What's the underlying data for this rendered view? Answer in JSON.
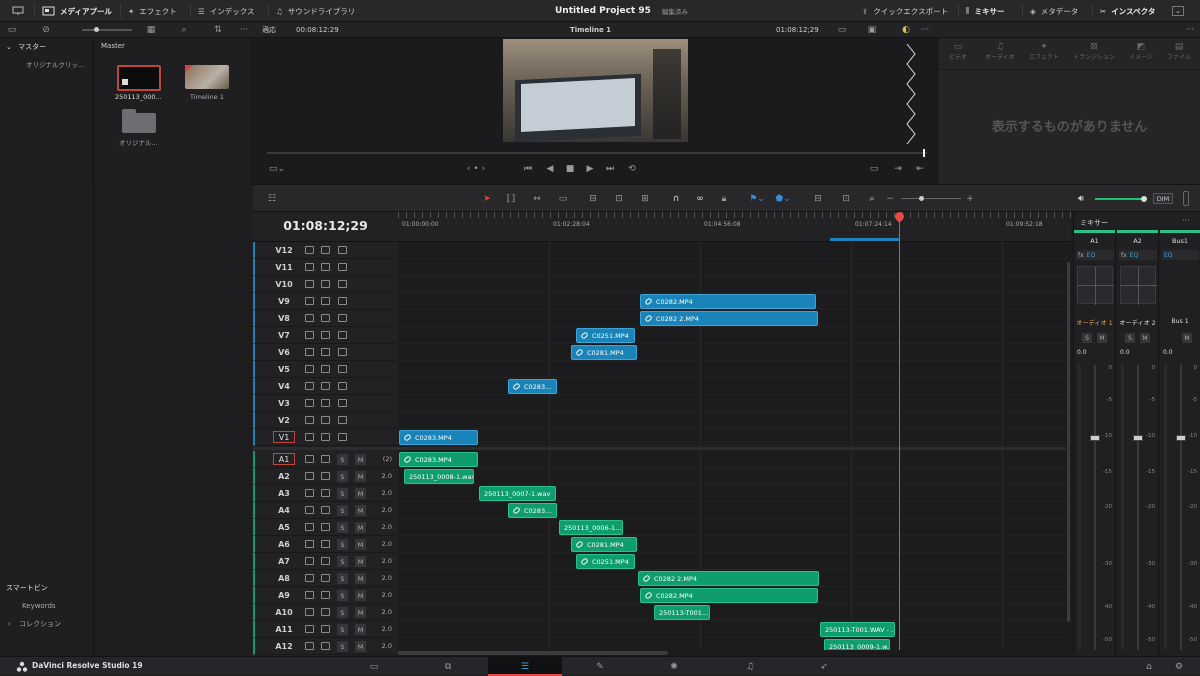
{
  "topbar": {
    "media_pool": "メディアプール",
    "effects": "エフェクト",
    "index": "インデックス",
    "sound_library": "サウンドライブラリ",
    "project_title": "Untitled Project 95",
    "project_status": "編集済み",
    "quick_export": "クイックエクスポート",
    "mixer": "ミキサー",
    "metadata": "メタデータ",
    "inspector": "インスペクタ"
  },
  "secondbar": {
    "fit": "適応",
    "timecode_left": "00:08:12:29",
    "timeline_name": "Timeline 1",
    "timecode_right": "01:08:12;29"
  },
  "left_panel": {
    "master_label": "マスター",
    "original_clips": "オリジナルクリッ...",
    "smart_bins": "スマートビン",
    "keywords": "Keywords",
    "collections": "コレクション"
  },
  "media_pool": {
    "header": "Master",
    "items": [
      {
        "label": "250113_000..."
      },
      {
        "label": "Timeline 1"
      },
      {
        "label": "オリジナル..."
      }
    ]
  },
  "inspector": {
    "tabs": [
      "ビデオ",
      "オーディオ",
      "エフェクト",
      "トランジション",
      "イメージ",
      "ファイル"
    ],
    "empty_message": "表示するものがありません"
  },
  "timeline": {
    "current_timecode": "01:08:12;29",
    "dim_label": "DIM",
    "ruler_labels": [
      "01:00:00:00",
      "01:02:28:04",
      "01:04:56:08",
      "01:07:24:14",
      "01:09:52:18"
    ],
    "video_tracks": [
      "V12",
      "V11",
      "V10",
      "V9",
      "V8",
      "V7",
      "V6",
      "V5",
      "V4",
      "V3",
      "V2",
      "V1"
    ],
    "audio_tracks": [
      {
        "name": "A1",
        "value": "(2)"
      },
      {
        "name": "A2",
        "value": "2.0"
      },
      {
        "name": "A3",
        "value": "2.0"
      },
      {
        "name": "A4",
        "value": "2.0"
      },
      {
        "name": "A5",
        "value": "2.0"
      },
      {
        "name": "A6",
        "value": "2.0"
      },
      {
        "name": "A7",
        "value": "2.0"
      },
      {
        "name": "A8",
        "value": "2.0"
      },
      {
        "name": "A9",
        "value": "2.0"
      },
      {
        "name": "A10",
        "value": "2.0"
      },
      {
        "name": "A11",
        "value": "2.0"
      },
      {
        "name": "A12",
        "value": "2.0"
      }
    ],
    "solo_label": "S",
    "mute_label": "M",
    "video_clips": [
      {
        "name": "C0282.MP4"
      },
      {
        "name": "C0282 2.MP4"
      },
      {
        "name": "C0251.MP4"
      },
      {
        "name": "C0281.MP4"
      },
      {
        "name": "C0283..."
      },
      {
        "name": "C0283.MP4"
      }
    ],
    "audio_clips": [
      {
        "name": "C0283.MP4"
      },
      {
        "name": "250113_0008-1.wav"
      },
      {
        "name": "250113_0007-1.wav"
      },
      {
        "name": "C0283..."
      },
      {
        "name": "250113_0006-1...."
      },
      {
        "name": "C0281.MP4"
      },
      {
        "name": "C0251.MP4"
      },
      {
        "name": "C0282 2.MP4"
      },
      {
        "name": "C0282.MP4"
      },
      {
        "name": "250113-T001..."
      },
      {
        "name": "250113-T001.WAV - ..."
      },
      {
        "name": "250113_0009-1.w..."
      }
    ]
  },
  "mixer": {
    "title": "ミキサー",
    "channels": [
      {
        "name": "A1",
        "track_label": "オーディオ 1",
        "level": "0.0"
      },
      {
        "name": "A2",
        "track_label": "オーディオ 2",
        "level": "0.0"
      },
      {
        "name": "Bus1",
        "track_label": "Bus 1",
        "level": "0.0"
      }
    ],
    "scale": [
      "0",
      "-5",
      "-10",
      "-15",
      "-20",
      "-30",
      "-40",
      "-50"
    ],
    "fx_label": "fx",
    "eq_label": "EQ"
  },
  "bottombar": {
    "app_name": "DaVinci Resolve Studio 19"
  }
}
